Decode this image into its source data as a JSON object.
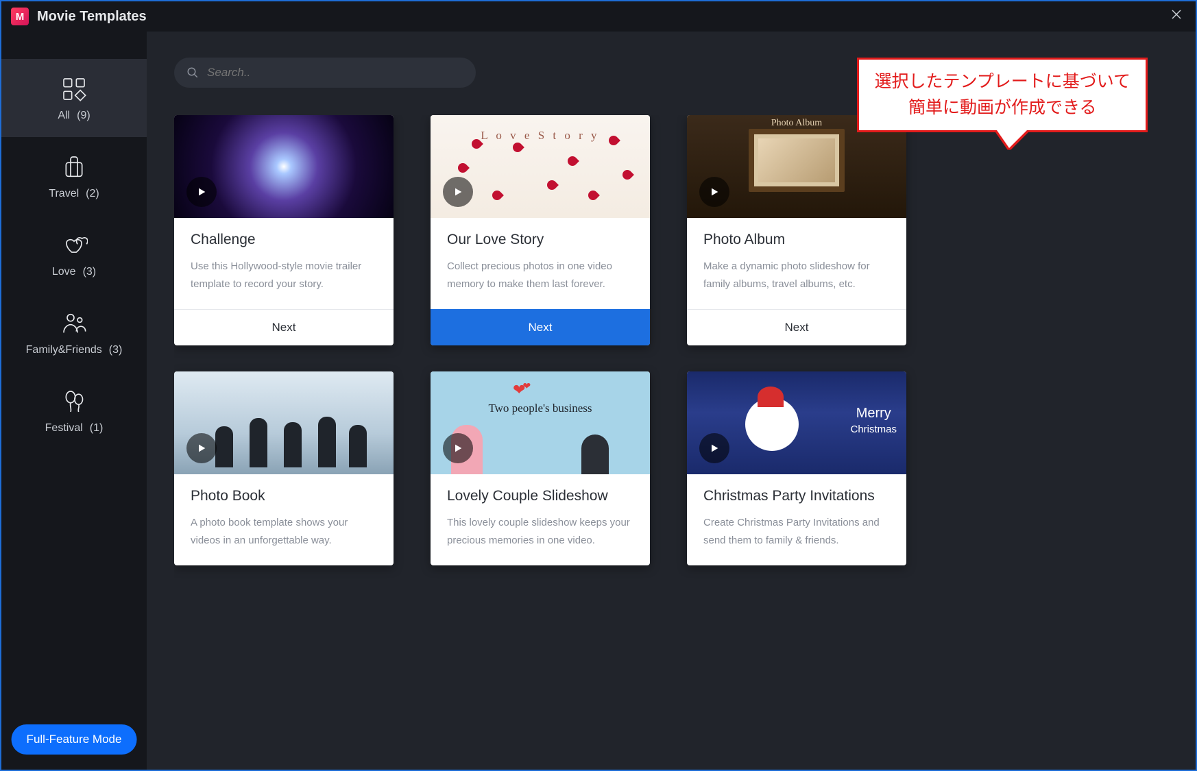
{
  "title": "Movie Templates",
  "search": {
    "placeholder": "Search.."
  },
  "sidebar": {
    "items": [
      {
        "label": "All",
        "count": "(9)"
      },
      {
        "label": "Travel",
        "count": "(2)"
      },
      {
        "label": "Love",
        "count": "(3)"
      },
      {
        "label": "Family&Friends",
        "count": "(3)"
      },
      {
        "label": "Festival",
        "count": "(1)"
      }
    ],
    "mode_button": "Full-Feature Mode"
  },
  "tooltip": {
    "line1": "選択したテンプレートに基づいて",
    "line2": "簡単に動画が作成できる"
  },
  "cards": [
    {
      "title": "Challenge",
      "desc": "Use this Hollywood-style movie trailer template to record your story.",
      "next": "Next"
    },
    {
      "title": "Our Love Story",
      "desc": "Collect precious photos in one video memory to make them last forever.",
      "next": "Next",
      "thumb_label": "L o v e S t o r y"
    },
    {
      "title": "Photo Album",
      "desc": "Make a dynamic photo slideshow for family albums, travel albums, etc.",
      "next": "Next",
      "thumb_label": "Photo Album"
    },
    {
      "title": "Photo Book",
      "desc": "A photo book template shows your videos in an unforgettable way."
    },
    {
      "title": "Lovely Couple Slideshow",
      "desc": "This lovely couple slideshow keeps your precious memories in one video.",
      "thumb_label": "Two people's business"
    },
    {
      "title": "Christmas Party Invitations",
      "desc": "Create Christmas Party Invitations and send them to family & friends.",
      "thumb_label_1": "Merry",
      "thumb_label_2": "Christmas"
    }
  ]
}
